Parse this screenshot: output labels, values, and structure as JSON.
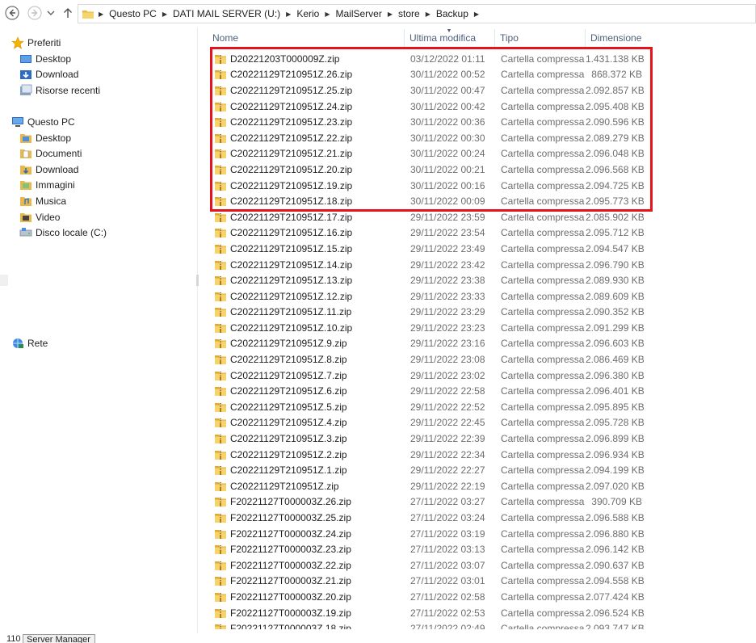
{
  "address_bar": {
    "crumbs": [
      "Questo PC",
      "DATI MAIL SERVER (U:)",
      "Kerio",
      "MailServer",
      "store",
      "Backup"
    ]
  },
  "sidebar": {
    "favorites_label": "Preferiti",
    "favorites": [
      "Desktop",
      "Download",
      "Risorse recenti"
    ],
    "pc_label": "Questo PC",
    "pc_items": [
      "Desktop",
      "Documenti",
      "Download",
      "Immagini",
      "Musica",
      "Video",
      "Disco locale (C:)"
    ],
    "network_label": "Rete"
  },
  "columns": {
    "name": "Nome",
    "date": "Ultima modifica",
    "type": "Tipo",
    "size": "Dimensione"
  },
  "files": [
    {
      "name": "D20221203T000009Z.zip",
      "date": "03/12/2022 01:11",
      "type": "Cartella compressa",
      "size": "1.431.138 KB"
    },
    {
      "name": "C20221129T210951Z.26.zip",
      "date": "30/11/2022 00:52",
      "type": "Cartella compressa",
      "size": "868.372 KB"
    },
    {
      "name": "C20221129T210951Z.25.zip",
      "date": "30/11/2022 00:47",
      "type": "Cartella compressa",
      "size": "2.092.857 KB"
    },
    {
      "name": "C20221129T210951Z.24.zip",
      "date": "30/11/2022 00:42",
      "type": "Cartella compressa",
      "size": "2.095.408 KB"
    },
    {
      "name": "C20221129T210951Z.23.zip",
      "date": "30/11/2022 00:36",
      "type": "Cartella compressa",
      "size": "2.090.596 KB"
    },
    {
      "name": "C20221129T210951Z.22.zip",
      "date": "30/11/2022 00:30",
      "type": "Cartella compressa",
      "size": "2.089.279 KB"
    },
    {
      "name": "C20221129T210951Z.21.zip",
      "date": "30/11/2022 00:24",
      "type": "Cartella compressa",
      "size": "2.096.048 KB"
    },
    {
      "name": "C20221129T210951Z.20.zip",
      "date": "30/11/2022 00:21",
      "type": "Cartella compressa",
      "size": "2.096.568 KB"
    },
    {
      "name": "C20221129T210951Z.19.zip",
      "date": "30/11/2022 00:16",
      "type": "Cartella compressa",
      "size": "2.094.725 KB"
    },
    {
      "name": "C20221129T210951Z.18.zip",
      "date": "30/11/2022 00:09",
      "type": "Cartella compressa",
      "size": "2.095.773 KB"
    },
    {
      "name": "C20221129T210951Z.17.zip",
      "date": "29/11/2022 23:59",
      "type": "Cartella compressa",
      "size": "2.085.902 KB"
    },
    {
      "name": "C20221129T210951Z.16.zip",
      "date": "29/11/2022 23:54",
      "type": "Cartella compressa",
      "size": "2.095.712 KB"
    },
    {
      "name": "C20221129T210951Z.15.zip",
      "date": "29/11/2022 23:49",
      "type": "Cartella compressa",
      "size": "2.094.547 KB"
    },
    {
      "name": "C20221129T210951Z.14.zip",
      "date": "29/11/2022 23:42",
      "type": "Cartella compressa",
      "size": "2.096.790 KB"
    },
    {
      "name": "C20221129T210951Z.13.zip",
      "date": "29/11/2022 23:38",
      "type": "Cartella compressa",
      "size": "2.089.930 KB"
    },
    {
      "name": "C20221129T210951Z.12.zip",
      "date": "29/11/2022 23:33",
      "type": "Cartella compressa",
      "size": "2.089.609 KB"
    },
    {
      "name": "C20221129T210951Z.11.zip",
      "date": "29/11/2022 23:29",
      "type": "Cartella compressa",
      "size": "2.090.352 KB"
    },
    {
      "name": "C20221129T210951Z.10.zip",
      "date": "29/11/2022 23:23",
      "type": "Cartella compressa",
      "size": "2.091.299 KB"
    },
    {
      "name": "C20221129T210951Z.9.zip",
      "date": "29/11/2022 23:16",
      "type": "Cartella compressa",
      "size": "2.096.603 KB"
    },
    {
      "name": "C20221129T210951Z.8.zip",
      "date": "29/11/2022 23:08",
      "type": "Cartella compressa",
      "size": "2.086.469 KB"
    },
    {
      "name": "C20221129T210951Z.7.zip",
      "date": "29/11/2022 23:02",
      "type": "Cartella compressa",
      "size": "2.096.380 KB"
    },
    {
      "name": "C20221129T210951Z.6.zip",
      "date": "29/11/2022 22:58",
      "type": "Cartella compressa",
      "size": "2.096.401 KB"
    },
    {
      "name": "C20221129T210951Z.5.zip",
      "date": "29/11/2022 22:52",
      "type": "Cartella compressa",
      "size": "2.095.895 KB"
    },
    {
      "name": "C20221129T210951Z.4.zip",
      "date": "29/11/2022 22:45",
      "type": "Cartella compressa",
      "size": "2.095.728 KB"
    },
    {
      "name": "C20221129T210951Z.3.zip",
      "date": "29/11/2022 22:39",
      "type": "Cartella compressa",
      "size": "2.096.899 KB"
    },
    {
      "name": "C20221129T210951Z.2.zip",
      "date": "29/11/2022 22:34",
      "type": "Cartella compressa",
      "size": "2.096.934 KB"
    },
    {
      "name": "C20221129T210951Z.1.zip",
      "date": "29/11/2022 22:27",
      "type": "Cartella compressa",
      "size": "2.094.199 KB"
    },
    {
      "name": "C20221129T210951Z.zip",
      "date": "29/11/2022 22:19",
      "type": "Cartella compressa",
      "size": "2.097.020 KB"
    },
    {
      "name": "F20221127T000003Z.26.zip",
      "date": "27/11/2022 03:27",
      "type": "Cartella compressa",
      "size": "390.709 KB"
    },
    {
      "name": "F20221127T000003Z.25.zip",
      "date": "27/11/2022 03:24",
      "type": "Cartella compressa",
      "size": "2.096.588 KB"
    },
    {
      "name": "F20221127T000003Z.24.zip",
      "date": "27/11/2022 03:19",
      "type": "Cartella compressa",
      "size": "2.096.880 KB"
    },
    {
      "name": "F20221127T000003Z.23.zip",
      "date": "27/11/2022 03:13",
      "type": "Cartella compressa",
      "size": "2.096.142 KB"
    },
    {
      "name": "F20221127T000003Z.22.zip",
      "date": "27/11/2022 03:07",
      "type": "Cartella compressa",
      "size": "2.090.637 KB"
    },
    {
      "name": "F20221127T000003Z.21.zip",
      "date": "27/11/2022 03:01",
      "type": "Cartella compressa",
      "size": "2.094.558 KB"
    },
    {
      "name": "F20221127T000003Z.20.zip",
      "date": "27/11/2022 02:58",
      "type": "Cartella compressa",
      "size": "2.077.424 KB"
    },
    {
      "name": "F20221127T000003Z.19.zip",
      "date": "27/11/2022 02:53",
      "type": "Cartella compressa",
      "size": "2.096.524 KB"
    },
    {
      "name": "F20221127T000003Z.18.zip",
      "date": "27/11/2022 02:49",
      "type": "Cartella compressa",
      "size": "2.093.747 KB"
    }
  ],
  "taskbar": {
    "number": "110",
    "app_label": "Server Manager"
  },
  "colors": {
    "highlight_border": "#e3141b",
    "header_text": "#4c607a",
    "folder_yellow": "#f2c94c"
  }
}
